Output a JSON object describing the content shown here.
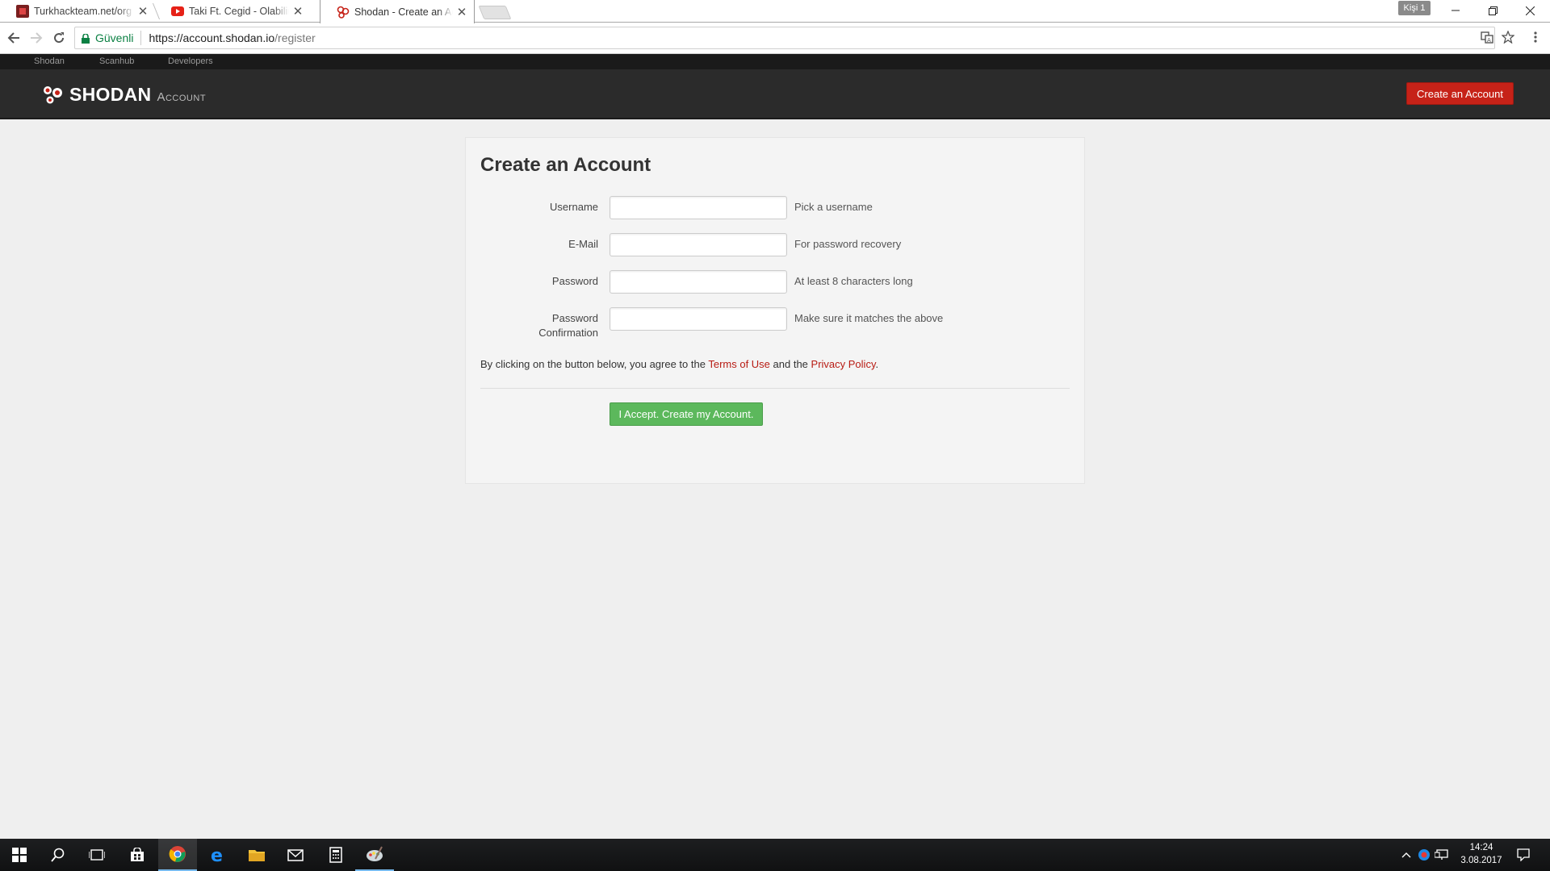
{
  "browser": {
    "tabs": [
      {
        "title": "Turkhackteam.net/org - T",
        "icon": "turkhackteam-favicon"
      },
      {
        "title": "Taki Ft. Cegid - Olabilir -",
        "icon": "youtube-favicon"
      },
      {
        "title": "Shodan - Create an Acco",
        "icon": "shodan-favicon",
        "active": true
      }
    ],
    "profile_label": "Kişi 1",
    "secure_label": "Güvenli",
    "url_host": "https://account.shodan.io",
    "url_path": "/register"
  },
  "site": {
    "topnav": [
      "Shodan",
      "Scanhub",
      "Developers"
    ],
    "logo_text": "SHODAN",
    "logo_sub": "Account",
    "header_button": "Create an Account",
    "accent_color": "#c62218"
  },
  "form": {
    "title": "Create an Account",
    "fields": [
      {
        "label": "Username",
        "hint": "Pick a username",
        "value": ""
      },
      {
        "label": "E-Mail",
        "hint": "For password recovery",
        "value": ""
      },
      {
        "label": "Password",
        "hint": "At least 8 characters long",
        "value": ""
      },
      {
        "label": "Password Confirmation",
        "hint": "Make sure it matches the above",
        "value": ""
      }
    ],
    "terms_prefix": "By clicking on the button below, you agree to the ",
    "terms_link": "Terms of Use",
    "terms_mid": " and the ",
    "privacy_link": "Privacy Policy",
    "terms_suffix": ".",
    "submit_label": "I Accept. Create my Account.",
    "submit_color": "#5cb85c"
  },
  "taskbar": {
    "time": "14:24",
    "date": "3.08.2017",
    "apps": [
      "start-icon",
      "search-icon",
      "task-view-icon",
      "store-icon",
      "chrome-icon",
      "edge-icon",
      "file-explorer-icon",
      "mail-icon",
      "calculator-icon",
      "paint-icon"
    ]
  }
}
